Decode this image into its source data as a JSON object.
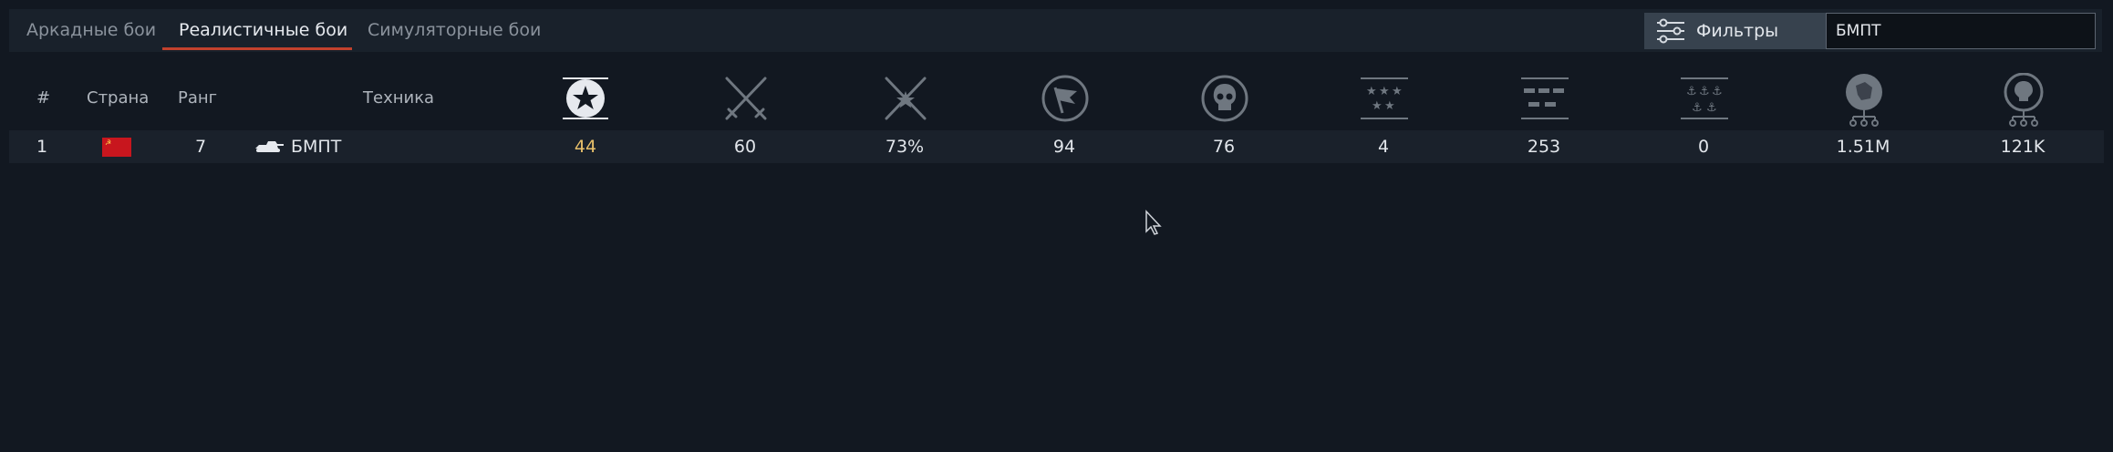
{
  "tabs": [
    {
      "label": "Аркадные бои",
      "active": false
    },
    {
      "label": "Реалистичные бои",
      "active": true
    },
    {
      "label": "Симуляторные бои",
      "active": false
    }
  ],
  "filters": {
    "label": "Фильтры",
    "icon": "sliders-icon"
  },
  "search": {
    "value": "БМПТ"
  },
  "columns": {
    "rank_num": "#",
    "country": "Страна",
    "tier": "Ранг",
    "vehicle": "Техника",
    "stat_icons": [
      "battles-star-icon",
      "victories-swords-icon",
      "win-rate-swords-icon",
      "captures-flag-icon",
      "deaths-skull-icon",
      "air-kills-stars-icon",
      "ground-kills-tanks-icon",
      "naval-kills-anchors-icon",
      "silver-lion-icon",
      "research-lightbulb-icon"
    ]
  },
  "rows": [
    {
      "num": "1",
      "country_icon": "ussr-flag-icon",
      "tier": "7",
      "vehicle": "БМПТ",
      "stats": [
        "44",
        "60",
        "73%",
        "94",
        "76",
        "4",
        "253",
        "0",
        "1.51M",
        "121K"
      ]
    }
  ],
  "colors": {
    "accent": "#c2412d",
    "highlight_value": "#e8c06a",
    "background": "#121821"
  }
}
